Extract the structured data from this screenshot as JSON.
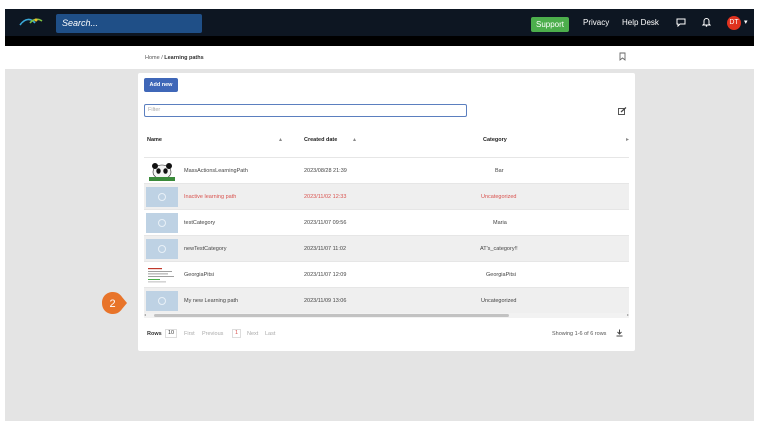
{
  "topbar": {
    "search_placeholder": "Search...",
    "support_label": "Support",
    "privacy_label": "Privacy",
    "helpdesk_label": "Help Desk",
    "avatar_initials": "DT"
  },
  "breadcrumb": {
    "home": "Home",
    "separator": "/",
    "current": "Learning paths"
  },
  "toolbar": {
    "add_new_label": "Add new",
    "filter_placeholder": "Filter"
  },
  "table": {
    "columns": [
      "Name",
      "Created date",
      "Category"
    ],
    "rows": [
      {
        "name": "MassActionsLearningPath",
        "created": "2023/08/28 21:39",
        "category": "Bar",
        "thumb": "panda",
        "inactive": false
      },
      {
        "name": "Inactive learning path",
        "created": "2023/11/02 12:33",
        "category": "Uncategorized",
        "thumb": "placeholder",
        "inactive": true
      },
      {
        "name": "testCategory",
        "created": "2023/11/07 09:56",
        "category": "Maria",
        "thumb": "placeholder",
        "inactive": false
      },
      {
        "name": "newTestCategory",
        "created": "2023/11/07 11:02",
        "category": "AT's_category!!",
        "thumb": "placeholder",
        "inactive": false
      },
      {
        "name": "GeorgiaPitsi",
        "created": "2023/11/07 12:09",
        "category": "GeorgiaPitsi",
        "thumb": "geo",
        "inactive": false
      },
      {
        "name": "My new Learning path",
        "created": "2023/11/09 13:06",
        "category": "Uncategorized",
        "thumb": "placeholder",
        "inactive": false
      }
    ]
  },
  "footer": {
    "rows_label": "Rows",
    "rows_value": "10",
    "first": "First",
    "previous": "Previous",
    "current_page": "1",
    "next": "Next",
    "last": "Last",
    "showing": "Showing 1-6 of 6 rows"
  },
  "callout": {
    "step_number": "2",
    "color": "#e8742a"
  },
  "colors": {
    "topbar": "#0d1622",
    "search": "#1f4f87",
    "support": "#4cae4c",
    "primary_button": "#3f67b8",
    "inactive_text": "#d9534f",
    "avatar": "#e0321f"
  },
  "icons": [
    "logo-icon",
    "chat-icon",
    "bell-icon",
    "bookmark-icon",
    "edit-columns-icon",
    "download-icon",
    "sort-icon"
  ]
}
